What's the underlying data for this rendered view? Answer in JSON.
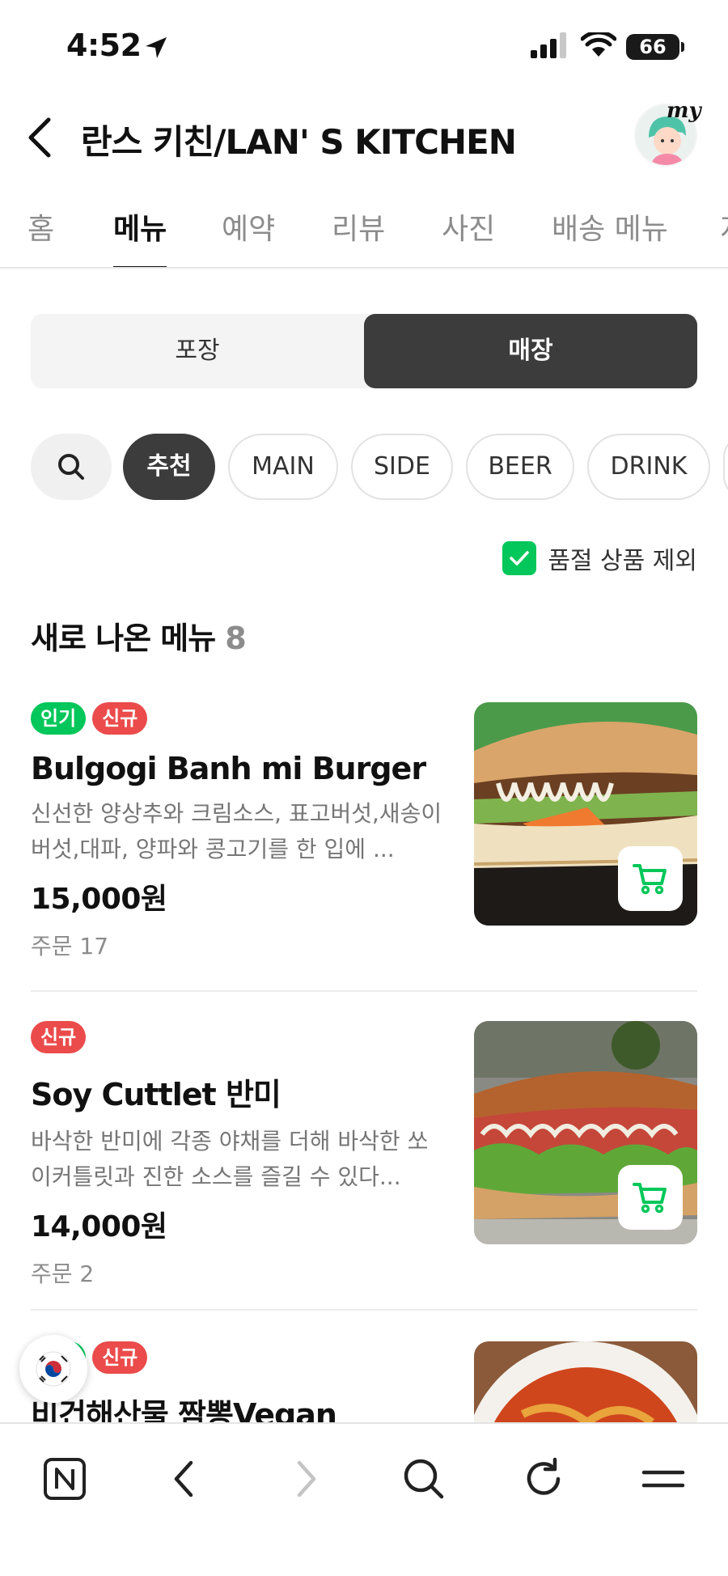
{
  "status_bar": {
    "time": "4:52",
    "battery": "66"
  },
  "header": {
    "title": "란스 키친/LAN' S KITCHEN",
    "my_label": "my"
  },
  "tabs": [
    {
      "label": "홈",
      "active": false
    },
    {
      "label": "메뉴",
      "active": true
    },
    {
      "label": "예약",
      "active": false
    },
    {
      "label": "리뷰",
      "active": false
    },
    {
      "label": "사진",
      "active": false
    },
    {
      "label": "배송 메뉴",
      "active": false
    },
    {
      "label": "지",
      "active": false
    }
  ],
  "segment": {
    "left": "포장",
    "right": "매장",
    "selected": "매장"
  },
  "chips": [
    "추천",
    "MAIN",
    "SIDE",
    "BEER",
    "DRINK"
  ],
  "active_chip": "추천",
  "filter": {
    "label": "품절 상품 제외",
    "checked": true
  },
  "section": {
    "title": "새로 나온 메뉴",
    "count": "8"
  },
  "menu_items": [
    {
      "badges": [
        {
          "text": "인기",
          "color": "#03c75a"
        },
        {
          "text": "신규",
          "color": "#eb4b4b"
        }
      ],
      "name": "Bulgogi Banh mi Burger",
      "description": "신선한 양상추와 크림소스, 표고버섯,새송이버섯,대파, 양파와 콩고기를 한 입에 ...",
      "price": "15,000원",
      "orders": "주문 17"
    },
    {
      "badges": [
        {
          "text": "신규",
          "color": "#eb4b4b"
        }
      ],
      "name": "Soy Cuttlet 반미",
      "description": "바삭한 반미에 각종 야채를 더해 바삭한 쏘이커틀릿과 진한 소스를 즐길 수 있다...",
      "price": "14,000원",
      "orders": "주문 2"
    },
    {
      "badges": [
        {
          "text": "인기",
          "color": "#03c75a"
        },
        {
          "text": "신규",
          "color": "#eb4b4b"
        }
      ],
      "name": "비건해산물 짬뽕Vegan"
    }
  ],
  "colors": {
    "accent_green": "#03c75a",
    "badge_red": "#eb4b4b",
    "dark_selected": "#3c3c3c"
  },
  "toolbar_icons": [
    "naver-home-icon",
    "back-icon",
    "forward-icon",
    "search-icon",
    "refresh-icon",
    "menu-icon"
  ]
}
